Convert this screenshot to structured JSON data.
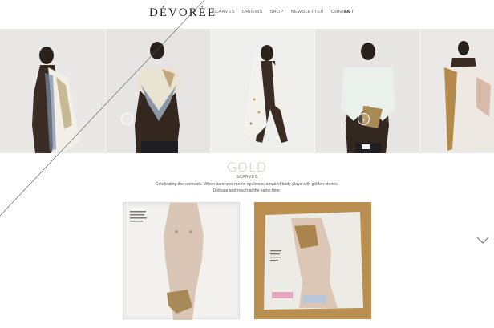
{
  "brand": {
    "logo_text": "DÉVORÉE"
  },
  "nav": {
    "items": [
      "SCARVES",
      "ORIGINS",
      "SHOP",
      "NEWSLETTER",
      "CONTACT"
    ]
  },
  "lang": {
    "fr": "FR",
    "separator": "|",
    "en": "EN",
    "active": "EN"
  },
  "hero": {
    "prev_arrow": "‹",
    "next_arrow": "›"
  },
  "collection": {
    "title": "GOLD",
    "subtitle": "SCARVES",
    "description": "Celebrating the contrasts. When bareness meets opulence, a naked body plays with golden stones. Delicate and rough at the same time."
  },
  "colors": {
    "accent_gold": "#c9c3b6",
    "gold_frame": "#b98e4f"
  },
  "icons": [
    "chevron-down-icon",
    "arrow-left-icon",
    "arrow-right-icon"
  ]
}
